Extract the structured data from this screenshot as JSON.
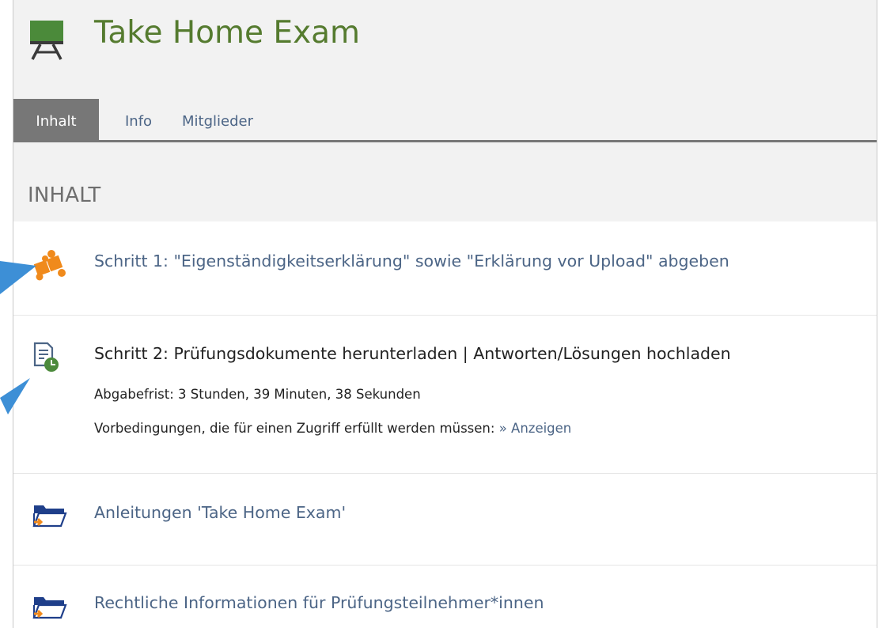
{
  "header": {
    "title": "Take Home Exam",
    "icon": "chalkboard-easel-icon"
  },
  "tabs": [
    {
      "label": "Inhalt",
      "active": true
    },
    {
      "label": "Info",
      "active": false
    },
    {
      "label": "Mitglieder",
      "active": false
    }
  ],
  "section": {
    "title": "INHALT"
  },
  "items": [
    {
      "icon": "puzzle-piece-icon",
      "label": "Schritt 1: \"Eigenständigkeitserklärung\" sowie \"Erklärung vor Upload\" abgeben"
    },
    {
      "icon": "document-clock-icon",
      "label": "Schritt 2: Prüfungsdokumente herunterladen | Antworten/Lösungen hochladen",
      "deadline": "Abgabefrist: 3 Stunden, 39 Minuten, 38 Sekunden",
      "prerequisite_text": "Vorbedingungen, die für einen Zugriff erfüllt werden müssen:",
      "prerequisite_link": "» Anzeigen"
    },
    {
      "icon": "folder-link-icon",
      "label": "Anleitungen 'Take Home Exam'"
    },
    {
      "icon": "folder-link-icon",
      "label": "Rechtliche Informationen für Prüfungsteilnehmer*innen"
    }
  ],
  "colors": {
    "title": "#557b2f",
    "link": "#4c6586",
    "active_tab": "#777777",
    "header_bg": "#f2f2f2",
    "puzzle": "#f08a1c",
    "annotation_arrow": "#3d8fd6"
  }
}
